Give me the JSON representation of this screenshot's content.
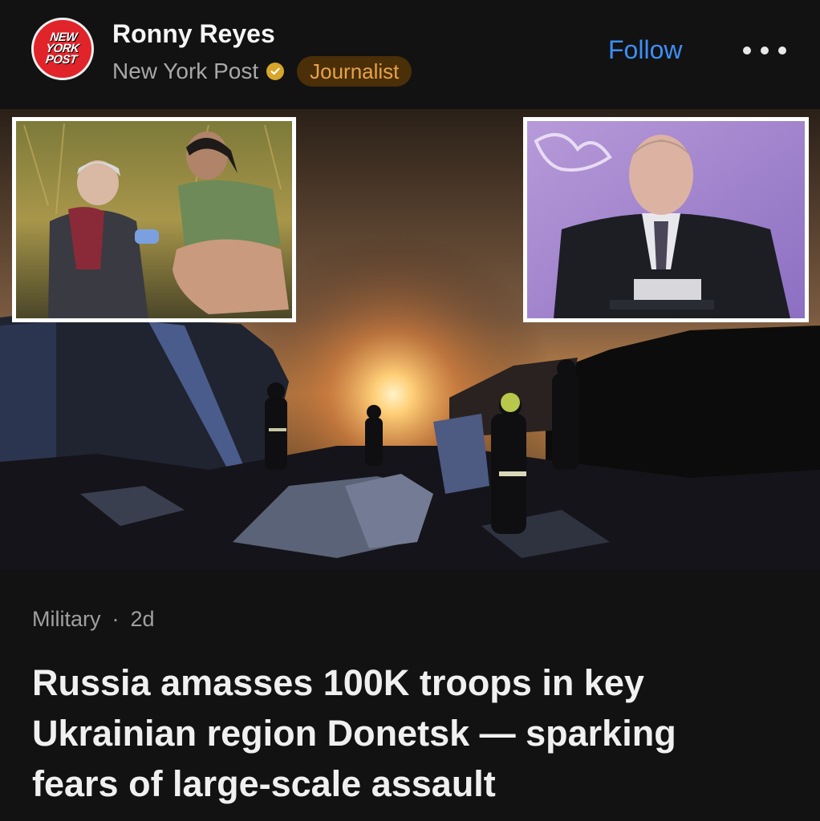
{
  "post": {
    "author_name": "Ronny Reyes",
    "publication": "New York Post",
    "role_badge": "Journalist",
    "follow_label": "Follow",
    "logo_text": [
      "NEW",
      "YORK",
      "POST"
    ],
    "verified_icon": "verified-check-icon",
    "more_icon": "more-horizontal-icon",
    "category": "Military",
    "separator": "·",
    "age": "2d",
    "headline": "Russia amasses 100K troops in key Ukrainian region Donetsk — sparking fears of large-scale assault"
  },
  "colors": {
    "background": "#121212",
    "follow": "#3d8ff5",
    "badge_bg": "#4a2f08",
    "badge_text": "#e8a24a",
    "logo_red": "#e0242a",
    "verified_gold": "#d7a62a"
  }
}
